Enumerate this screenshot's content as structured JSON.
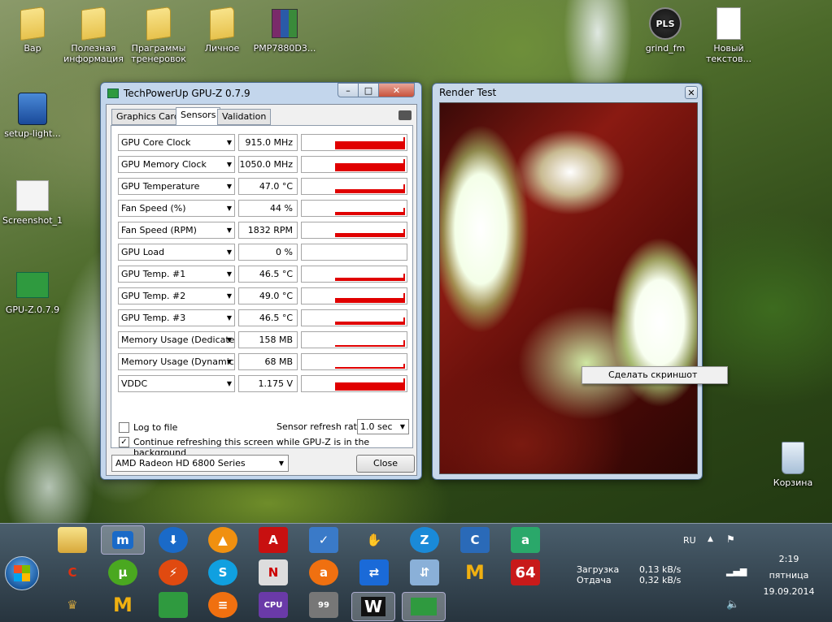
{
  "desktop": {
    "icons": [
      {
        "label": "Вар"
      },
      {
        "label": "Полезная информация"
      },
      {
        "label": "Праграммы тренеровок"
      },
      {
        "label": "Личное"
      },
      {
        "label": "PMP7880D3..."
      },
      {
        "label": "grind_fm"
      },
      {
        "label": "Новый текстов..."
      },
      {
        "label": "setup-light..."
      },
      {
        "label": "Screenshot_1"
      },
      {
        "label": "GPU-Z.0.7.9"
      },
      {
        "label": "Корзина"
      }
    ]
  },
  "gpuz": {
    "title": "TechPowerUp GPU-Z 0.7.9",
    "tabs": [
      {
        "label": "Graphics Card"
      },
      {
        "label": "Sensors"
      },
      {
        "label": "Validation"
      }
    ],
    "sensors": [
      {
        "name": "GPU Core Clock",
        "value": "915.0 MHz",
        "level": 0.55
      },
      {
        "name": "GPU Memory Clock",
        "value": "1050.0 MHz",
        "level": 0.55
      },
      {
        "name": "GPU Temperature",
        "value": "47.0 °C",
        "level": 0.3
      },
      {
        "name": "Fan Speed (%)",
        "value": "44 %",
        "level": 0.2
      },
      {
        "name": "Fan Speed (RPM)",
        "value": "1832 RPM",
        "level": 0.25
      },
      {
        "name": "GPU Load",
        "value": "0 %",
        "level": 0
      },
      {
        "name": "GPU Temp. #1",
        "value": "46.5 °C",
        "level": 0.2
      },
      {
        "name": "GPU Temp. #2",
        "value": "49.0 °C",
        "level": 0.35
      },
      {
        "name": "GPU Temp. #3",
        "value": "46.5 °C",
        "level": 0.2
      },
      {
        "name": "Memory Usage (Dedicated)",
        "value": "158 MB",
        "level": 0.12
      },
      {
        "name": "Memory Usage (Dynamic)",
        "value": "68 MB",
        "level": 0.06
      },
      {
        "name": "VDDC",
        "value": "1.175 V",
        "level": 0.55
      }
    ],
    "log_label": "Log to file",
    "refresh_label": "Sensor refresh rate:",
    "refresh_value": "1.0 sec",
    "continue_label": "Continue refreshing this screen while GPU-Z is in the background",
    "device": "AMD Radeon HD 6800 Series",
    "close_label": "Close"
  },
  "render": {
    "title": "Render Test",
    "context_item": "Сделать скриншот"
  },
  "taskbar": {
    "lang": "RU",
    "net_load_label": "Загрузка",
    "net_load_value": "0,13 kB/s",
    "net_send_label": "Отдача",
    "net_send_value": "0,32 kB/s",
    "time": "2:19",
    "weekday": "пятница",
    "date": "19.09.2014",
    "badge_64": "64"
  }
}
